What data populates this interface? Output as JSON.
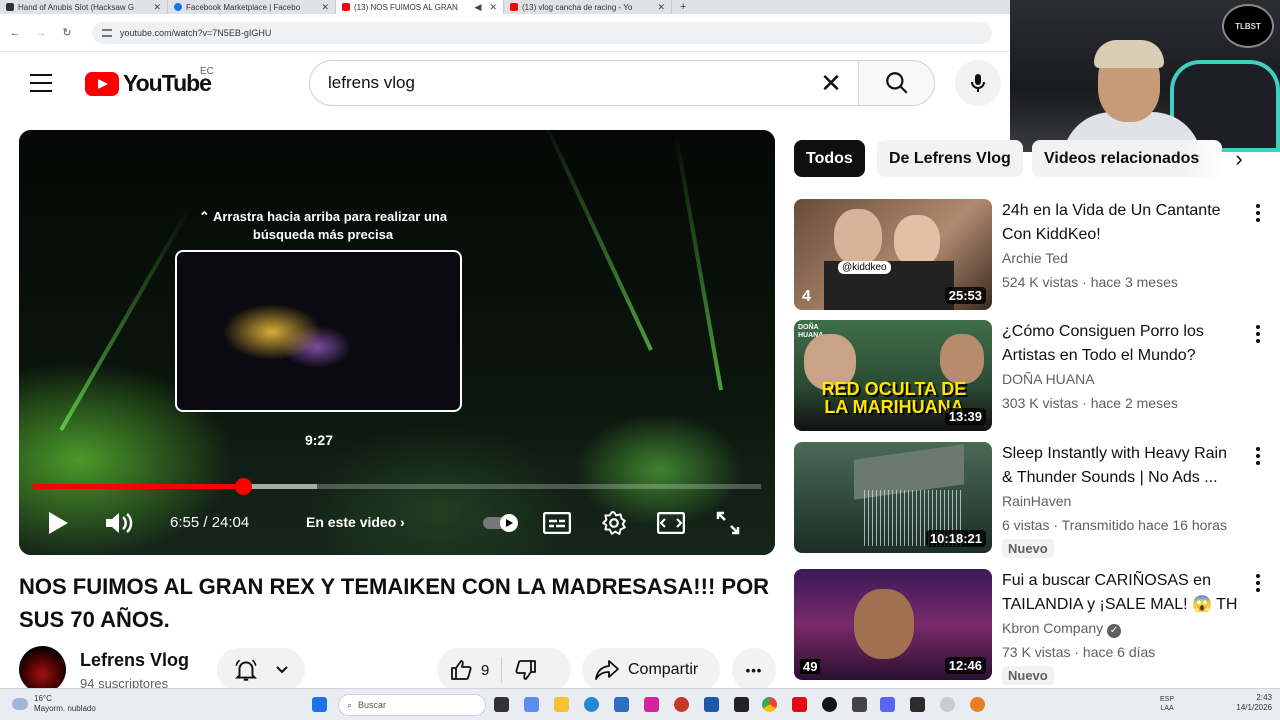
{
  "browser": {
    "tabs": [
      {
        "title": "Hand of Anubis Slot (Hacksaw G",
        "color": "#333333",
        "active": false
      },
      {
        "title": "Facebook Marketplace | Facebo",
        "color": "#1877f2",
        "active": false
      },
      {
        "title": "(13) NOS FUIMOS AL GRAN",
        "color": "#ff0000",
        "active": true
      },
      {
        "title": "(13) vlog cancha de racing - Yo",
        "color": "#ff0000",
        "active": false
      }
    ],
    "new_tab": "+",
    "close": "✕",
    "url": "youtube.com/watch?v=7N5EB-gIGHU"
  },
  "header": {
    "logo_text": "YouTube",
    "country_code": "EC",
    "search_value": "lefrens vlog",
    "clear_symbol": "✕"
  },
  "webcam": {
    "badge": "TLBST"
  },
  "player": {
    "hint": "⌃ Arrastra hacia arriba para realizar una búsqueda más precisa",
    "preview_time": "9:27",
    "time": "6:55 / 24:04",
    "chapter": "En este video",
    "played_fraction": 0.288,
    "buffered_fraction": 0.39
  },
  "video": {
    "title": "NOS FUIMOS AL GRAN REX Y TEMAIKEN CON LA MADRESASA!!! POR SUS 70 AÑOS.",
    "channel": "Lefrens Vlog",
    "subscribers": "94 suscriptores",
    "likes": "9",
    "share": "Compartir",
    "more": "•••"
  },
  "chips": [
    "Todos",
    "De Lefrens Vlog",
    "Videos relacionados"
  ],
  "recommendations": [
    {
      "title": "24h en la Vida de Un Cantante Con KiddKeo!",
      "channel": "Archie Ted",
      "meta": "524 K vistas · hace 3 meses",
      "duration": "25:53",
      "badge": "",
      "bg": "#7a5a48"
    },
    {
      "title": "¿Cómo Consiguen Porro los Artistas en Todo el Mundo?",
      "channel": "DOÑA HUANA",
      "meta": "303 K vistas · hace 2 meses",
      "duration": "13:39",
      "badge": "",
      "bg": "#3b5a3a"
    },
    {
      "title": "Sleep Instantly with Heavy Rain & Thunder Sounds | No Ads ...",
      "channel": "RainHaven",
      "meta": "6 vistas · Transmitido hace 16 horas",
      "duration": "10:18:21",
      "badge": "Nuevo",
      "bg": "#3c5646"
    },
    {
      "title": "Fui a buscar CARIÑOSAS en TAILANDIA y ¡SALE MAL! 😱 TH",
      "channel": "Kbron Company",
      "meta": "73 K vistas · hace 6 días",
      "duration": "12:46",
      "badge": "Nuevo",
      "bg": "#5a2a6a"
    }
  ],
  "thumb_texts": {
    "r1_handle": "@kiddkeo",
    "r1_num": "4",
    "r2_overlay": "RED OCULTA DE LA MARIHUANA",
    "r2_brand": "DOÑA HUANA",
    "r4_num": "49"
  },
  "taskbar": {
    "temp": "16°C",
    "weather": "Mayorm. nublado",
    "search": "Buscar",
    "lang1": "ESP",
    "lang2": "LAA",
    "time": "2:43",
    "date": "14/1/2026"
  }
}
